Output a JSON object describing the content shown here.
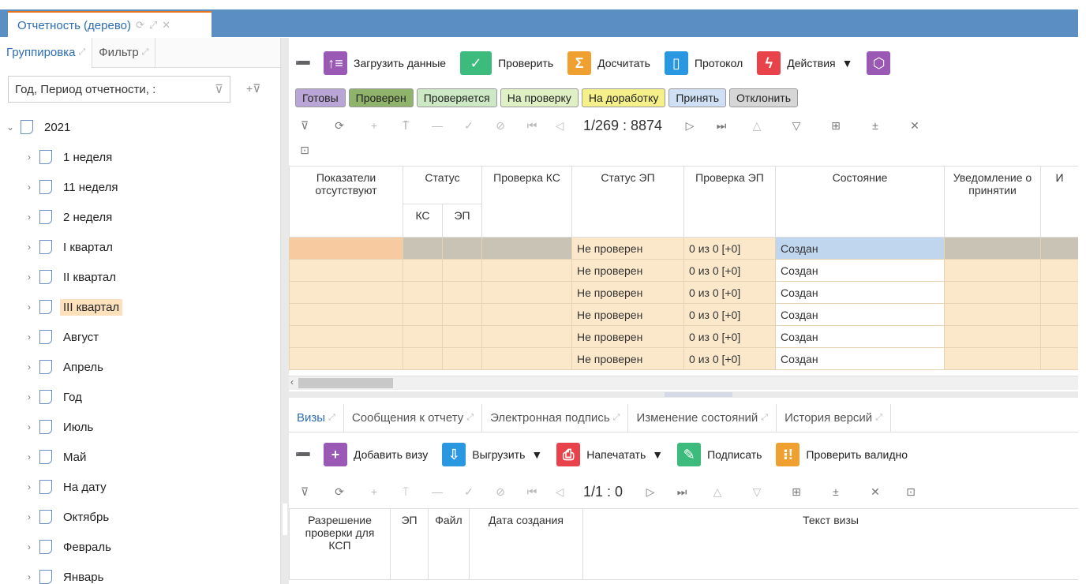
{
  "window": {
    "tab_title": "Отчетность (дерево)"
  },
  "left": {
    "tabs": [
      {
        "label": "Группировка"
      },
      {
        "label": "Фильтр"
      }
    ],
    "grouping_value": "Год, Период отчетности, :",
    "tree": [
      {
        "label": "2021",
        "expanded": true
      },
      {
        "label": "1 неделя"
      },
      {
        "label": "11 неделя"
      },
      {
        "label": "2 неделя"
      },
      {
        "label": "I квартал"
      },
      {
        "label": "II квартал"
      },
      {
        "label": "III квартал",
        "selected": true
      },
      {
        "label": "Август"
      },
      {
        "label": "Апрель"
      },
      {
        "label": "Год"
      },
      {
        "label": "Июль"
      },
      {
        "label": "Май"
      },
      {
        "label": "На дату"
      },
      {
        "label": "Октябрь"
      },
      {
        "label": "Февраль"
      },
      {
        "label": "Январь"
      }
    ]
  },
  "toolbar": {
    "load": "Загрузить данные",
    "check": "Проверить",
    "recalc": "Досчитать",
    "protocol": "Протокол",
    "actions": "Действия"
  },
  "status_buttons": [
    {
      "label": "Готовы",
      "color": "#b9a6d6"
    },
    {
      "label": "Проверен",
      "color": "#8fb36a"
    },
    {
      "label": "Проверяется",
      "color": "#cde8c4"
    },
    {
      "label": "На проверку",
      "color": "#dff0c4"
    },
    {
      "label": "На доработку",
      "color": "#f6f08a"
    },
    {
      "label": "Принять",
      "color": "#cfe0f5"
    },
    {
      "label": "Отклонить",
      "color": "#d6d6d6"
    }
  ],
  "grid": {
    "pager": "1/269 : 8874",
    "headers": {
      "absent": "Показатели отсутствуют",
      "status": "Статус",
      "ks": "КС",
      "ep": "ЭП",
      "check_ks": "Проверка КС",
      "status_ep": "Статус ЭП",
      "check_ep": "Проверка ЭП",
      "state": "Состояние",
      "notice": "Уведомление о принятии",
      "extra": "И"
    },
    "rows": [
      {
        "status_ep": "Не проверен",
        "check_ep": "0 из 0 [+0]",
        "state": "Создан"
      },
      {
        "status_ep": "Не проверен",
        "check_ep": "0 из 0 [+0]",
        "state": "Создан"
      },
      {
        "status_ep": "Не проверен",
        "check_ep": "0 из 0 [+0]",
        "state": "Создан"
      },
      {
        "status_ep": "Не проверен",
        "check_ep": "0 из 0 [+0]",
        "state": "Создан"
      },
      {
        "status_ep": "Не проверен",
        "check_ep": "0 из 0 [+0]",
        "state": "Создан"
      },
      {
        "status_ep": "Не проверен",
        "check_ep": "0 из 0 [+0]",
        "state": "Создан"
      }
    ]
  },
  "bottom": {
    "tabs": [
      {
        "label": "Визы"
      },
      {
        "label": "Сообщения к отчету"
      },
      {
        "label": "Электронная подпись"
      },
      {
        "label": "Изменение состояний"
      },
      {
        "label": "История версий"
      }
    ],
    "toolbar": {
      "add_visa": "Добавить визу",
      "export": "Выгрузить",
      "print": "Напечатать",
      "sign": "Подписать",
      "validate": "Проверить валидно"
    },
    "pager": "1/1 : 0",
    "headers": {
      "permission": "Разрешение проверки для КСП",
      "ep": "ЭП",
      "file": "Файл",
      "created": "Дата создания",
      "text": "Текст визы"
    }
  }
}
